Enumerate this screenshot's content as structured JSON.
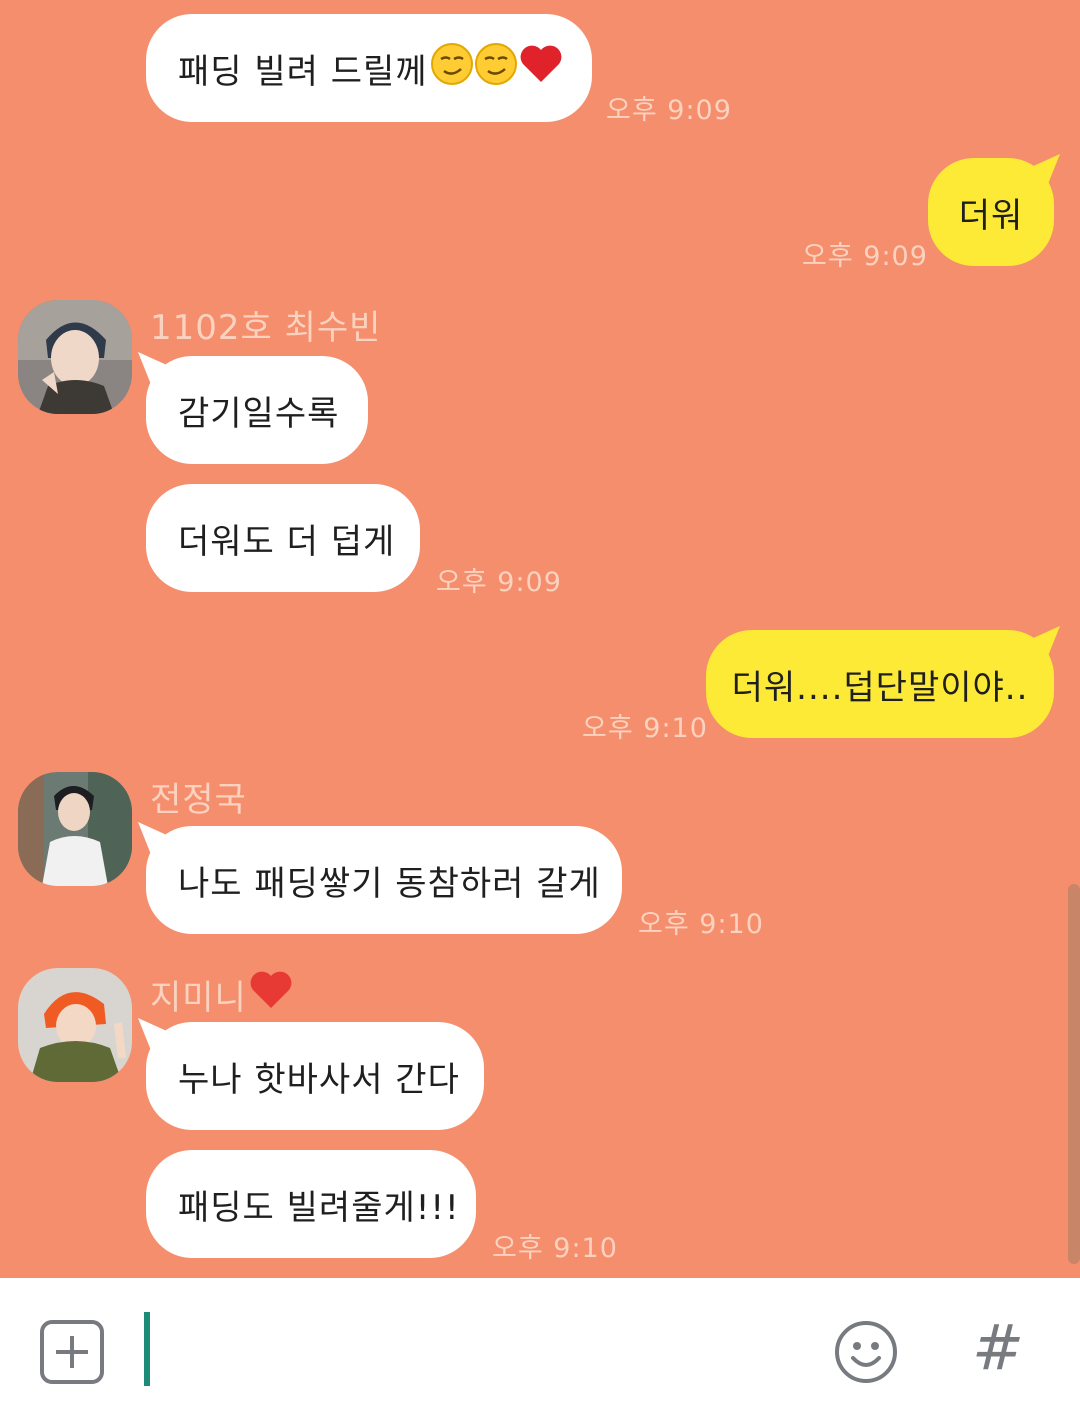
{
  "messages": {
    "m1": {
      "text": "패딩 빌려 드릴께",
      "time": "오후 9:09"
    },
    "m2": {
      "text": "더워",
      "time": "오후 9:09"
    },
    "m3": {
      "sender": "1102호 최수빈",
      "text": "감기일수록"
    },
    "m4": {
      "text": "더워도 더 덥게",
      "time": "오후 9:09"
    },
    "m5": {
      "text": "더워....덥단말이야..",
      "time": "오후 9:10"
    },
    "m6": {
      "sender": "전정국",
      "text": "나도 패딩쌓기 동참하러 갈게",
      "time": "오후 9:10"
    },
    "m7": {
      "sender": "지미니",
      "text": "누나 핫바사서 간다"
    },
    "m8": {
      "text": "패딩도 빌려줄게!!!",
      "time": "오후 9:10"
    }
  },
  "icons": {
    "add": "plus-icon",
    "emoji": "smiley-icon",
    "hashtag": "hashtag-icon"
  },
  "input": {
    "hashtag_label": "#"
  },
  "colors": {
    "background": "#f48e6c",
    "incoming_bubble": "#ffffff",
    "outgoing_bubble": "#fdea37",
    "timestamp": "#fbd2bf",
    "cursor": "#1e8b78"
  }
}
